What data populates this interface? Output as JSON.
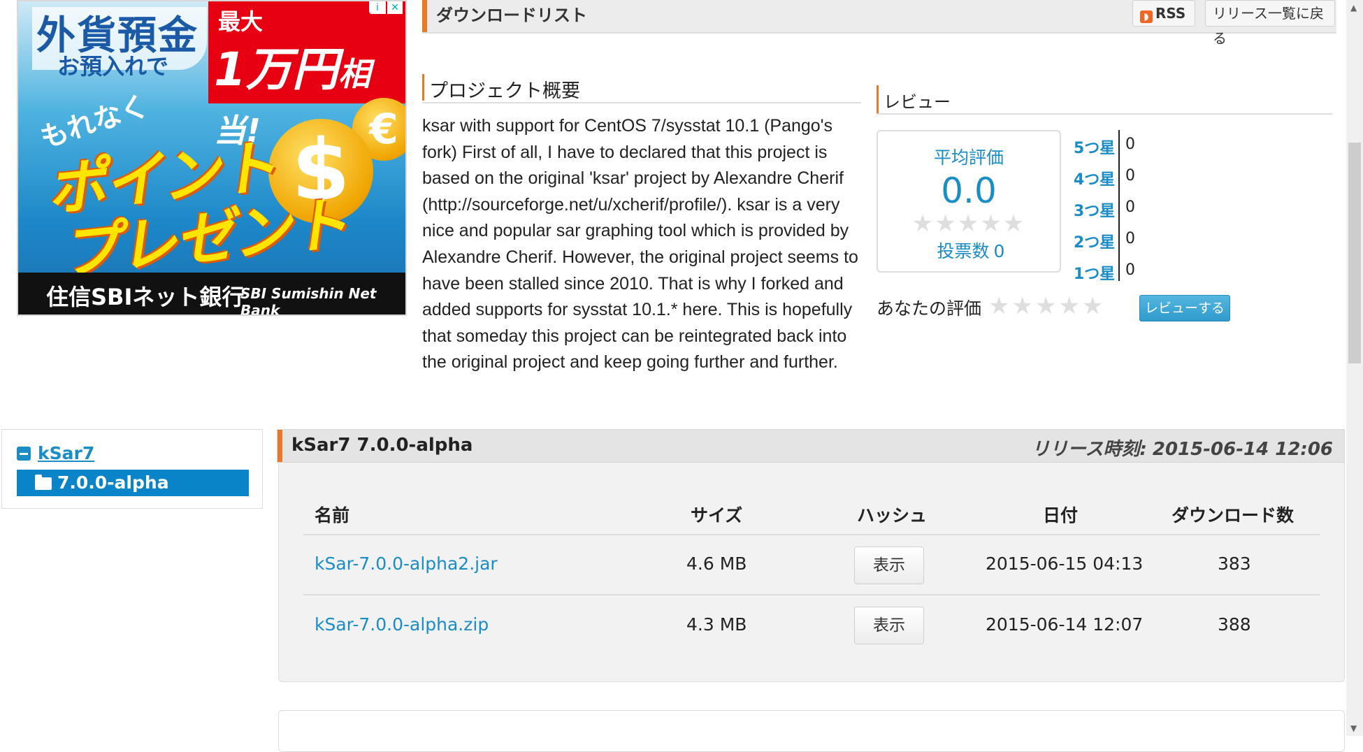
{
  "ad": {
    "line1": "外貨預金",
    "line2": "お預入れで",
    "red_line1": "最大",
    "red_line2": "1万円",
    "red_line2_suffix": "相当!",
    "motto": "もれなく",
    "promo1": "ポイント",
    "promo2": "プレゼント",
    "bank_name": "住信SBIネット銀行",
    "bank_logo": "SBI Sumishin Net Bank",
    "coin_dollar": "$",
    "coin_euro": "€",
    "info_icon": "i",
    "close_icon": "✕"
  },
  "header": {
    "title": "ダウンロードリスト",
    "rss_label": "RSS",
    "back_label": "リリース一覧に戻る"
  },
  "overview": {
    "heading": "プロジェクト概要",
    "text": "ksar with support for CentOS 7/sysstat 10.1 (Pango's fork) First of all, I have to declared that this project is based on the original 'ksar' project by Alexandre Cherif (http://sourceforge.net/u/xcherif/profile/). ksar is a very nice and popular sar graphing tool which is provided by Alexandre Cherif. However, the original project seems to have been stalled since 2010. That is why I forked and added supports for sysstat 10.1.* here. This is hopefully that someday this project can be reintegrated back into the original project and keep going further and further."
  },
  "review": {
    "heading": "レビュー",
    "avg_label": "平均評価",
    "avg_value": "0.0",
    "votes_label": "投票数",
    "votes_value": "0",
    "distribution": [
      {
        "label": "5つ星",
        "count": "0"
      },
      {
        "label": "4つ星",
        "count": "0"
      },
      {
        "label": "3つ星",
        "count": "0"
      },
      {
        "label": "2つ星",
        "count": "0"
      },
      {
        "label": "1つ星",
        "count": "0"
      }
    ],
    "my_rating_label": "あなたの評価",
    "review_button": "レビューする",
    "star_glyph": "★★★★★"
  },
  "tree": {
    "parent": "kSar7",
    "child": "7.0.0-alpha"
  },
  "release": {
    "name": "kSar7 7.0.0-alpha",
    "time_label": "リリース時刻:",
    "time_value": "2015-06-14 12:06",
    "columns": [
      "名前",
      "サイズ",
      "ハッシュ",
      "日付",
      "ダウンロード数"
    ],
    "files": [
      {
        "name": "kSar-7.0.0-alpha2.jar",
        "size": "4.6 MB",
        "hash": "表示",
        "date": "2015-06-15 04:13",
        "downloads": "383"
      },
      {
        "name": "kSar-7.0.0-alpha.zip",
        "size": "4.3 MB",
        "hash": "表示",
        "date": "2015-06-14 12:07",
        "downloads": "388"
      }
    ]
  },
  "colors": {
    "accent": "#e8792b",
    "link": "#1a8cc6",
    "selected": "#0a84c9"
  }
}
